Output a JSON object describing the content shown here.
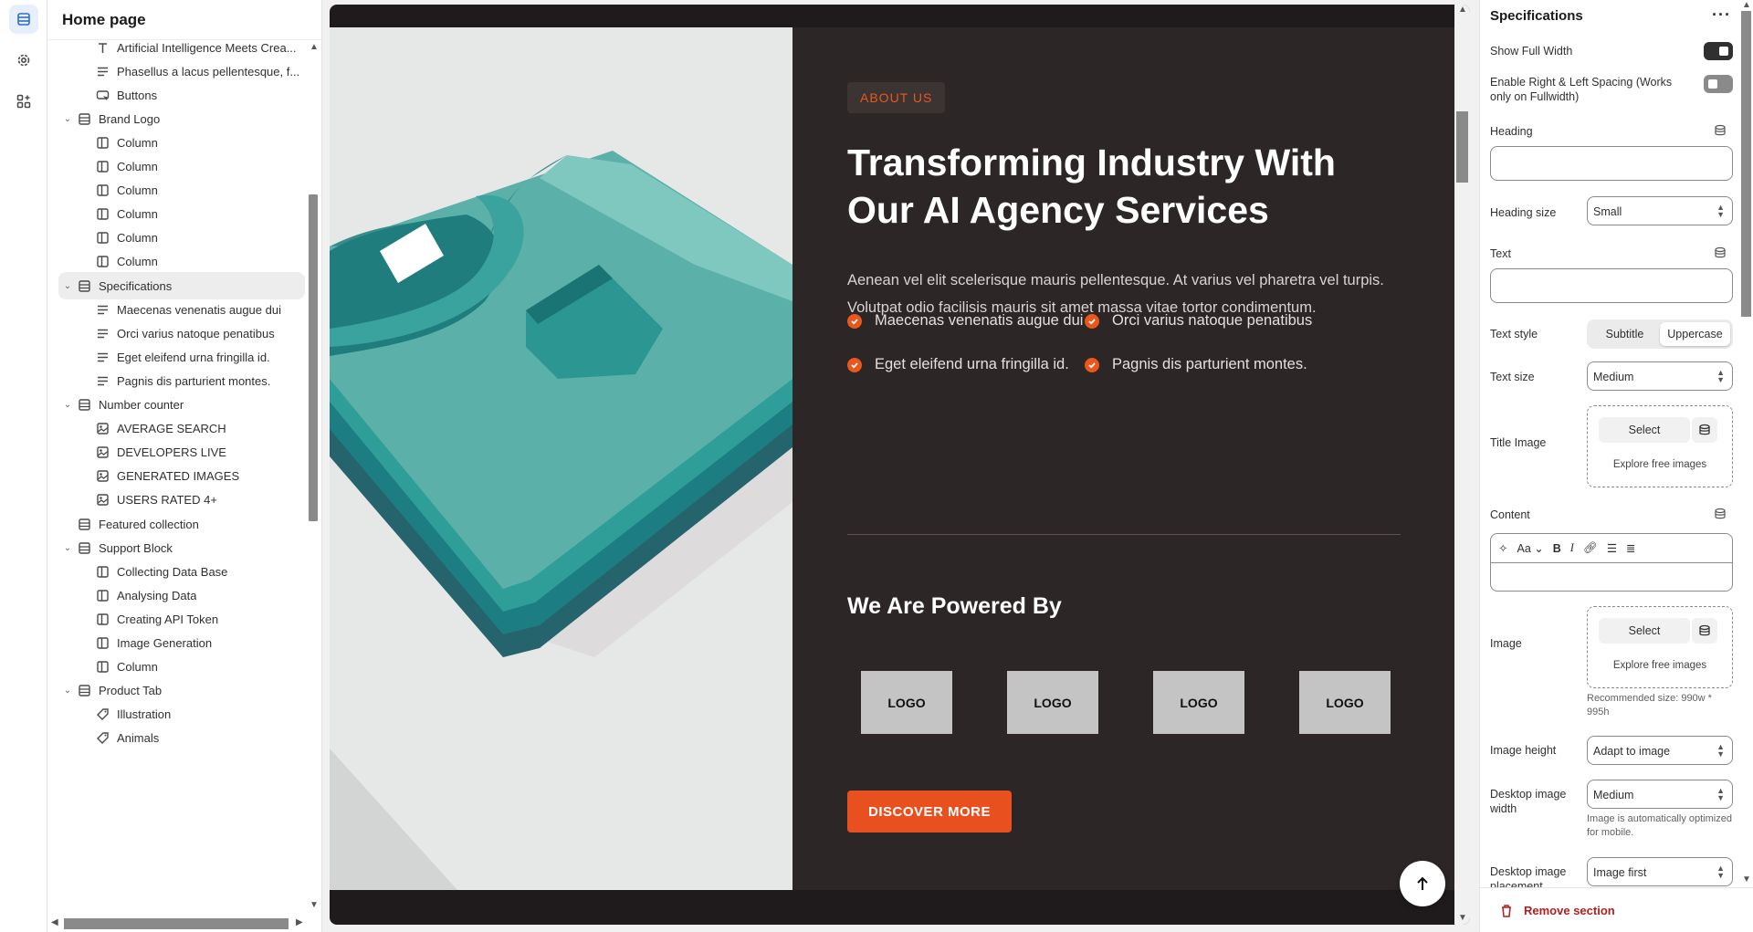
{
  "sidebar": {
    "title": "Home page",
    "items": [
      {
        "label": "Artificial Intelligence Meets Crea...",
        "icon": "text-icon",
        "level": 2
      },
      {
        "label": "Phasellus a lacus pellentesque, f...",
        "icon": "paragraph-icon",
        "level": 2
      },
      {
        "label": "Buttons",
        "icon": "button-icon",
        "level": 2
      },
      {
        "label": "Brand Logo",
        "icon": "section-icon",
        "level": 1,
        "expanded": true
      },
      {
        "label": "Column",
        "icon": "column-icon",
        "level": 2
      },
      {
        "label": "Column",
        "icon": "column-icon",
        "level": 2
      },
      {
        "label": "Column",
        "icon": "column-icon",
        "level": 2
      },
      {
        "label": "Column",
        "icon": "column-icon",
        "level": 2
      },
      {
        "label": "Column",
        "icon": "column-icon",
        "level": 2
      },
      {
        "label": "Column",
        "icon": "column-icon",
        "level": 2
      },
      {
        "label": "Specifications",
        "icon": "section-icon",
        "level": 1,
        "expanded": true,
        "selected": true
      },
      {
        "label": "Maecenas venenatis augue dui",
        "icon": "paragraph-icon",
        "level": 2
      },
      {
        "label": "Orci varius natoque penatibus",
        "icon": "paragraph-icon",
        "level": 2
      },
      {
        "label": "Eget eleifend urna fringilla id.",
        "icon": "paragraph-icon",
        "level": 2
      },
      {
        "label": "Pagnis dis parturient montes.",
        "icon": "paragraph-icon",
        "level": 2
      },
      {
        "label": "Number counter",
        "icon": "section-icon",
        "level": 1,
        "expanded": true
      },
      {
        "label": "AVERAGE SEARCH",
        "icon": "image-icon",
        "level": 2
      },
      {
        "label": "DEVELOPERS LIVE",
        "icon": "image-icon",
        "level": 2
      },
      {
        "label": "GENERATED IMAGES",
        "icon": "image-icon",
        "level": 2
      },
      {
        "label": "USERS RATED 4+",
        "icon": "image-icon",
        "level": 2
      },
      {
        "label": "Featured collection",
        "icon": "section-icon",
        "level": 1,
        "expanded": false
      },
      {
        "label": "Support Block",
        "icon": "section-icon",
        "level": 1,
        "expanded": true
      },
      {
        "label": "Collecting Data Base",
        "icon": "column-icon",
        "level": 2
      },
      {
        "label": "Analysing Data",
        "icon": "column-icon",
        "level": 2
      },
      {
        "label": "Creating API Token",
        "icon": "column-icon",
        "level": 2
      },
      {
        "label": "Image Generation",
        "icon": "column-icon",
        "level": 2
      },
      {
        "label": "Column",
        "icon": "column-icon",
        "level": 2
      },
      {
        "label": "Product Tab",
        "icon": "section-icon",
        "level": 1,
        "expanded": true
      },
      {
        "label": "Illustration",
        "icon": "tag-icon",
        "level": 2
      },
      {
        "label": "Animals",
        "icon": "tag-icon",
        "level": 2
      }
    ]
  },
  "preview": {
    "badge": "ABOUT US",
    "title": "Transforming Industry With Our AI Agency Services",
    "text": "Aenean vel elit scelerisque mauris pellentesque. At varius vel pharetra vel turpis. Volutpat odio facilisis mauris sit amet massa vitae tortor condimentum.",
    "features": [
      "Maecenas venenatis augue dui",
      "Orci varius natoque penatibus",
      "Eget eleifend urna fringilla id.",
      "Pagnis dis parturient montes."
    ],
    "powered_title": "We Are Powered By",
    "logos": [
      "LOGO",
      "LOGO",
      "LOGO",
      "LOGO"
    ],
    "cta_label": "DISCOVER MORE",
    "colors": {
      "accent": "#e9571d",
      "dark_bg": "#2c2627",
      "shirt": "#5bb1aa"
    }
  },
  "panel": {
    "title": "Specifications",
    "show_full_width_label": "Show Full Width",
    "show_full_width": true,
    "spacing_label": "Enable Right & Left Spacing (Works only on Fullwidth)",
    "spacing": false,
    "heading_label": "Heading",
    "heading_value": "",
    "heading_size_label": "Heading size",
    "heading_size_value": "Small",
    "text_label": "Text",
    "text_value": "",
    "text_style_label": "Text style",
    "text_style_options": [
      "Subtitle",
      "Uppercase"
    ],
    "text_style_selected": "Uppercase",
    "text_size_label": "Text size",
    "text_size_value": "Medium",
    "title_image_label": "Title Image",
    "select_label": "Select",
    "explore_label": "Explore free images",
    "content_label": "Content",
    "image_label": "Image",
    "recommended_hint": "Recommended size: 990w * 995h",
    "image_height_label": "Image height",
    "image_height_value": "Adapt to image",
    "desktop_width_label": "Desktop image width",
    "desktop_width_value": "Medium",
    "desktop_width_hint": "Image is automatically optimized for mobile.",
    "placement_label": "Desktop image placement",
    "placement_value": "Image first",
    "remove_label": "Remove section"
  }
}
